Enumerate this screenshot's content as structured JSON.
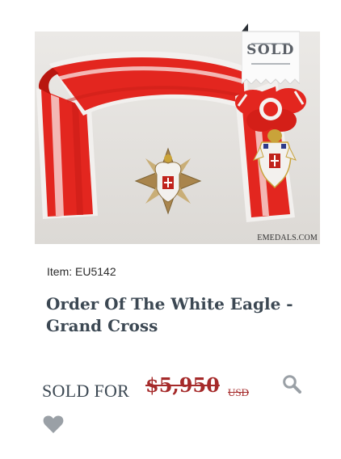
{
  "product": {
    "image_alt": "Order Of The White Eagle - Grand Cross",
    "watermark": "EMEDALS.COM",
    "sold_badge": "SOLD",
    "item_number": "Item: EU5142",
    "title": "Order Of The White Eagle - Grand Cross",
    "sold_for_label": "SOLD FOR",
    "price": "$5,950",
    "currency": "USD"
  },
  "icons": {
    "zoom": "magnifier-icon",
    "wishlist": "heart-icon"
  },
  "colors": {
    "title": "#3c4853",
    "price": "#a52a2a",
    "icon": "#9aa0a6",
    "sash_red": "#e3261f"
  }
}
